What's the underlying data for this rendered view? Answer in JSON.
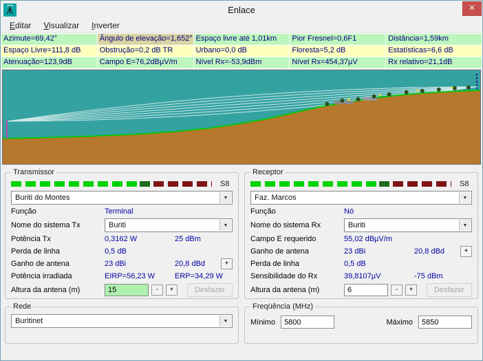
{
  "window": {
    "title": "Enlace",
    "close_glyph": "✕"
  },
  "menu": {
    "items": [
      "Editar",
      "Visualizar",
      "Inverter"
    ]
  },
  "info": {
    "row1": [
      "Azimute=69,42°",
      "Ângulo de elevação=1,652°",
      "Espaço livre até 1,01km",
      "Pior Fresnel=0,6F1",
      "Distância=1,59km"
    ],
    "row2": [
      "Espaço Livre=111,8 dB",
      "Obstrução=0,2 dB TR",
      "Urbano=0,0 dB",
      "Floresta=5,2 dB",
      "Estatísticas=6,6 dB"
    ],
    "row3": [
      "Atenuação=123,9dB",
      "Campo E=76,2dBµV/m",
      "Nível Rx=-53,9dBm",
      "Nível Rx=454,37µV",
      "Rx relativo=21,1dB"
    ]
  },
  "tx": {
    "title": "Transmissor",
    "meter_label": "S8",
    "station": "Buriti do Montes",
    "funcao_label": "Função",
    "funcao_value": "Terminal",
    "sistema_label": "Nome do sistema Tx",
    "sistema_value": "Buriti",
    "potencia_label": "Potência Tx",
    "potencia_w": "0,3162 W",
    "potencia_dbm": "25 dBm",
    "perda_label": "Perda de linha",
    "perda_value": "0,5 dB",
    "ganho_label": "Ganho de antena",
    "ganho_dbi": "23 dBi",
    "ganho_dbd": "20,8 dBd",
    "plus_label": "+",
    "minus_label": "-",
    "irradiada_label": "Potência irradiada",
    "eirp": "EIRP=56,23 W",
    "erp": "ERP=34,29 W",
    "altura_label": "Altura da antena (m)",
    "altura_value": "15",
    "undo_label": "Desfazer"
  },
  "rx": {
    "title": "Receptor",
    "meter_label": "S8",
    "station": "Faz. Marcos",
    "funcao_label": "Função",
    "funcao_value": "Nó",
    "sistema_label": "Nome do sistema Rx",
    "sistema_value": "Buriti",
    "campo_label": "Campo E requerido",
    "campo_value": "55,02 dBµV/m",
    "ganho_label": "Ganho de antena",
    "ganho_dbi": "23 dBi",
    "ganho_dbd": "20,8 dBd",
    "plus_label": "+",
    "minus_label": "-",
    "perda_label": "Perda de linha",
    "perda_value": "0,5 dB",
    "sens_label": "Sensibilidade do Rx",
    "sens_uv": "39,8107µV",
    "sens_dbm": "-75 dBm",
    "altura_label": "Altura da antena (m)",
    "altura_value": "6",
    "undo_label": "Desfazer"
  },
  "rede": {
    "title": "Rede",
    "value": "Buritinet"
  },
  "freq": {
    "title": "Freqüência (MHz)",
    "min_label": "Mínimo",
    "min_value": "5800",
    "max_label": "Máximo",
    "max_value": "5850"
  },
  "colors": {
    "value_text": "#0000a0",
    "info_green": "#bdf6bd",
    "info_yellow": "#feffbd",
    "info_tan": "#d9d2a3",
    "sky": "#35a2a2",
    "terrain": "#b5782d",
    "terrain_outline": "#00cc00",
    "changed_field": "#aef0ae"
  }
}
